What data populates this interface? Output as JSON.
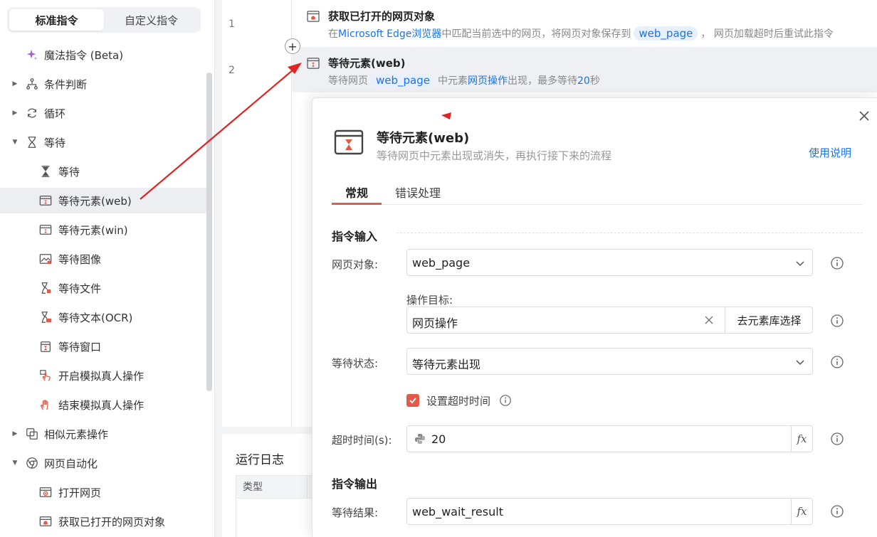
{
  "sidebar": {
    "tabs": [
      "标准指令",
      "自定义指令"
    ],
    "items": [
      {
        "label": "魔法指令 (Beta)"
      },
      {
        "label": "条件判断"
      },
      {
        "label": "循环"
      },
      {
        "label": "等待"
      },
      {
        "label": "等待"
      },
      {
        "label": "等待元素(web)"
      },
      {
        "label": "等待元素(win)"
      },
      {
        "label": "等待图像"
      },
      {
        "label": "等待文件"
      },
      {
        "label": "等待文本(OCR)"
      },
      {
        "label": "等待窗口"
      },
      {
        "label": "开启模拟真人操作"
      },
      {
        "label": "结束模拟真人操作"
      },
      {
        "label": "相似元素操作"
      },
      {
        "label": "网页自动化"
      },
      {
        "label": "打开网页"
      },
      {
        "label": "获取已打开的网页对象"
      }
    ]
  },
  "editor": {
    "steps": [
      {
        "line": "1",
        "title": "获取已打开的网页对象",
        "desc": {
          "t1": "在",
          "browser": "Microsoft Edge浏览器",
          "t2": "中匹配当前选中的网页，将网页对象保存到",
          "var": "web_page",
          "t3": "， 网页加载超时后重试此指令"
        }
      },
      {
        "line": "2",
        "title": "等待元素(web)",
        "desc": {
          "t1": "等待网页",
          "var": "web_page",
          "t2": "中元素",
          "target": "网页操作",
          "t3": "出现，最多等待",
          "seconds": "20",
          "t4": "秒"
        }
      }
    ],
    "plus_symbol": "+"
  },
  "log": {
    "title": "运行日志",
    "columns": [
      "类型"
    ]
  },
  "dialog": {
    "title": "等待元素(web)",
    "subtitle": "等待网页中元素出现或消失，再执行接下来的流程",
    "help": "使用说明",
    "tabs": [
      "常规",
      "错误处理"
    ],
    "input_section": "指令输入",
    "output_section": "指令输出",
    "fields": {
      "web_object": {
        "label": "网页对象:",
        "value": "web_page"
      },
      "target": {
        "label": "操作目标:",
        "value": "网页操作",
        "button": "去元素库选择"
      },
      "wait_state": {
        "label": "等待状态:",
        "value": "等待元素出现"
      },
      "timeout_checkbox": {
        "label": "设置超时时间",
        "checked": true
      },
      "timeout": {
        "label": "超时时间(s):",
        "value": "20"
      },
      "result": {
        "label": "等待结果:",
        "value": "web_wait_result"
      }
    },
    "fx_label": "fx"
  },
  "colors": {
    "accent_red": "#e25a4a",
    "link_blue": "#1a73e8",
    "annotation_red": "#e02424"
  }
}
